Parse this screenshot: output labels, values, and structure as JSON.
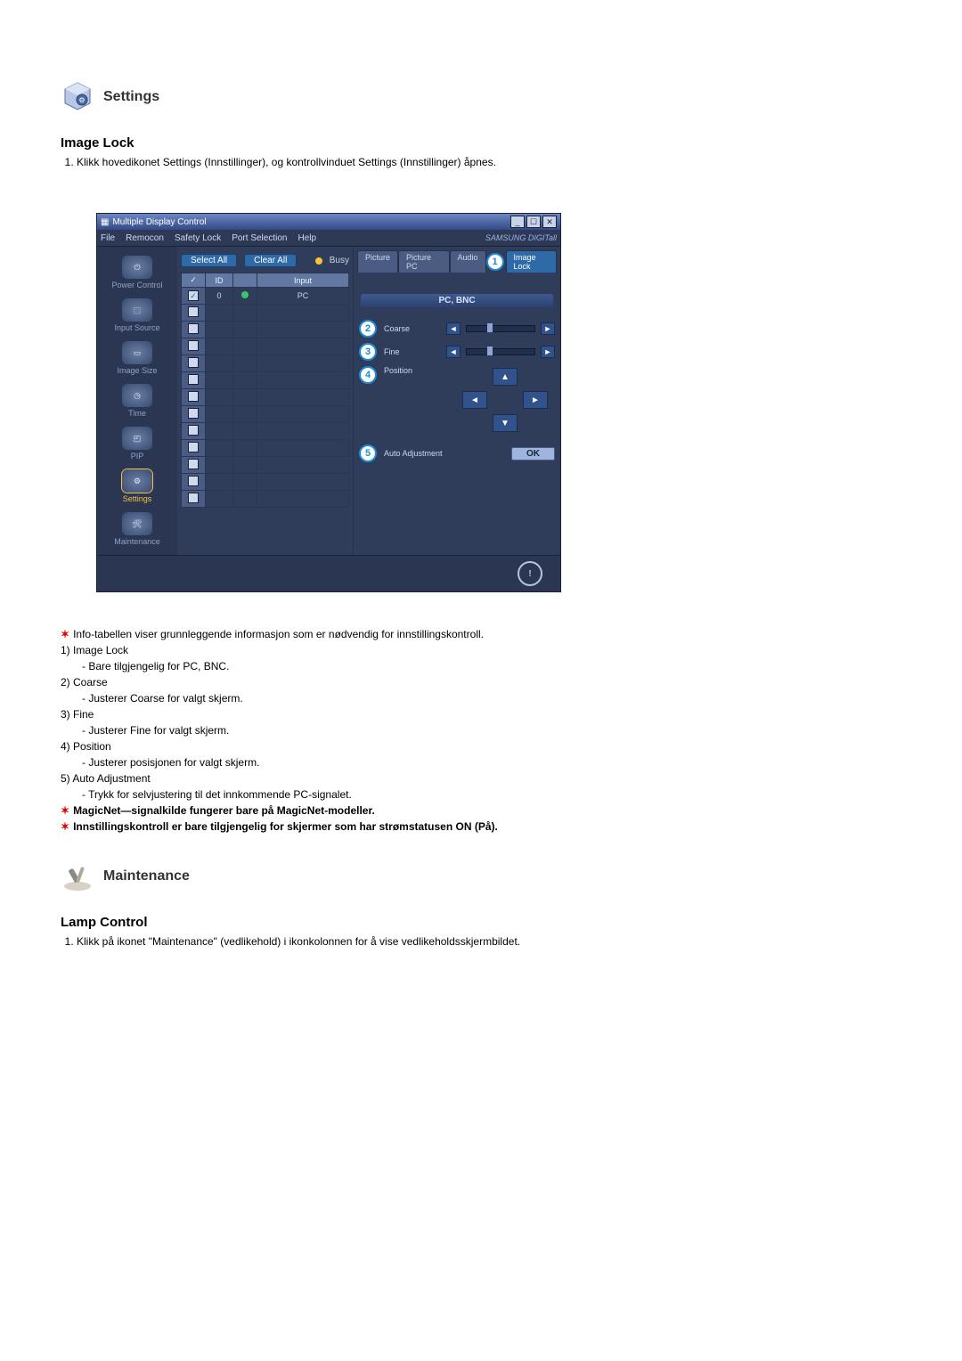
{
  "section1": {
    "title": "Settings",
    "subtitle": "Image Lock"
  },
  "section1_step": "Klikk hovedikonet Settings (Innstillinger), og kontrollvinduet Settings (Innstillinger) åpnes.",
  "app": {
    "window_title": "Multiple Display Control",
    "menus": [
      "File",
      "Remocon",
      "Safety Lock",
      "Port Selection",
      "Help"
    ],
    "brand": "SAMSUNG DIGITall",
    "nav": {
      "power": "Power Control",
      "input": "Input Source",
      "image": "Image Size",
      "time": "Time",
      "pip": "PIP",
      "settings": "Settings",
      "maintenance": "Maintenance"
    },
    "list": {
      "select_all": "Select All",
      "clear_all": "Clear All",
      "busy": "Busy",
      "col_check": "✓",
      "col_id": "ID",
      "col_power": " ",
      "col_input": "Input",
      "row0_id": "0",
      "row0_input": "PC"
    },
    "tabs": {
      "picture": "Picture",
      "picture_pc": "Picture PC",
      "audio": "Audio",
      "image_lock": "Image Lock"
    },
    "strip": "PC, BNC",
    "coarse": "Coarse",
    "fine": "Fine",
    "position": "Position",
    "auto_adjust": "Auto Adjustment",
    "ok": "OK"
  },
  "desc": {
    "info_line": "Info-tabellen viser grunnleggende informasjon som er nødvendig for innstillingskontroll.",
    "i1_t": "Image Lock",
    "i1_s": "- Bare tilgjengelig for PC, BNC.",
    "i2_t": "Coarse",
    "i2_s": "- Justerer Coarse for valgt skjerm.",
    "i3_t": "Fine",
    "i3_s": "- Justerer Fine for valgt skjerm.",
    "i4_t": "Position",
    "i4_s": "- Justerer posisjonen for valgt skjerm.",
    "i5_t": "Auto Adjustment",
    "i5_s": "- Trykk for selvjustering til det innkommende PC-signalet.",
    "warn1": "MagicNet—signalkilde fungerer bare på MagicNet-modeller.",
    "warn2": "Innstillingskontroll er bare tilgjengelig for skjermer som har strømstatusen ON (På)."
  },
  "section2": {
    "title": "Maintenance",
    "subtitle": "Lamp Control"
  },
  "section2_step": "Klikk på ikonet \"Maintenance\" (vedlikehold) i ikonkolonnen for å vise vedlikeholdsskjermbildet."
}
